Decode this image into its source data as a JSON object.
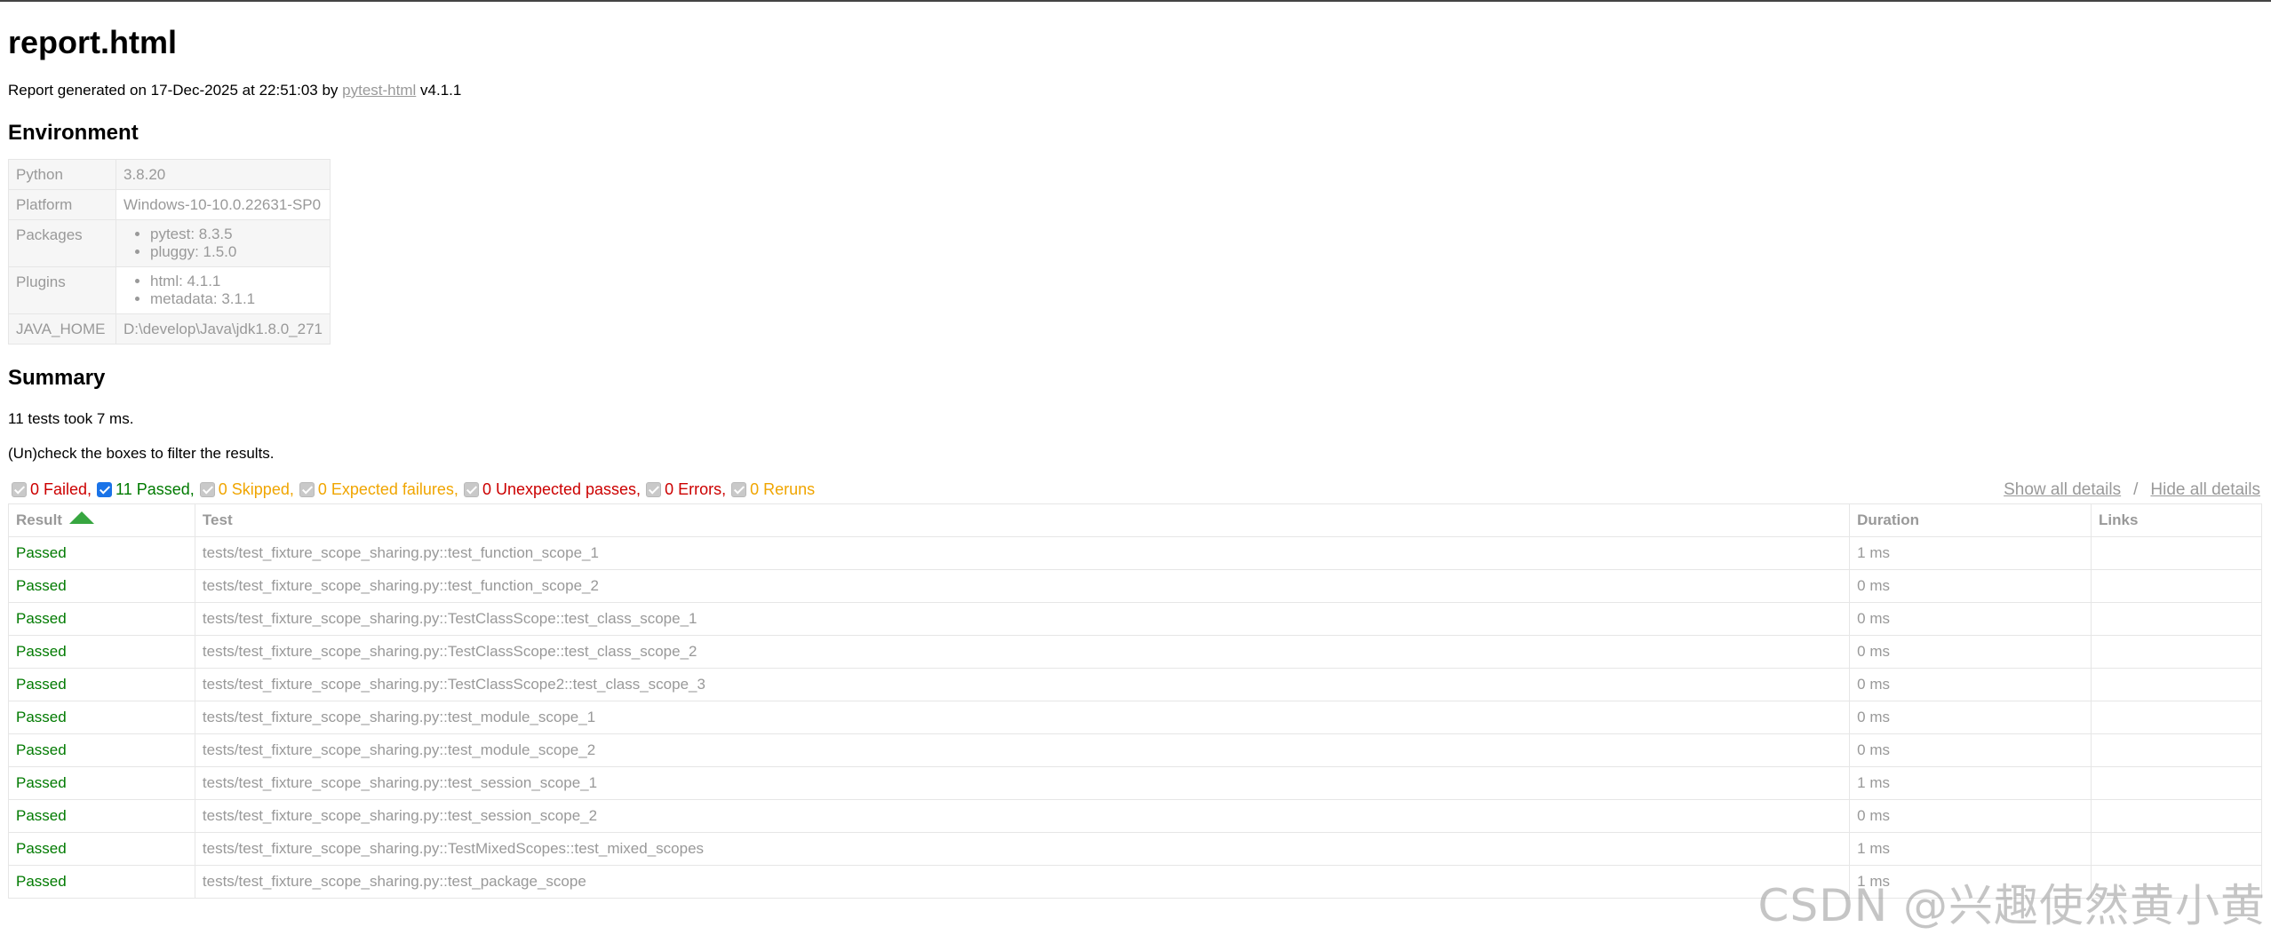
{
  "title": "report.html",
  "generated": {
    "prefix": "Report generated on 17-Dec-2025 at 22:51:03 by ",
    "link": "pytest-html",
    "suffix": " v4.1.1"
  },
  "environment": {
    "heading": "Environment",
    "python": {
      "key": "Python",
      "value": "3.8.20"
    },
    "platform": {
      "key": "Platform",
      "value": "Windows-10-10.0.22631-SP0"
    },
    "packages": {
      "key": "Packages",
      "items": [
        "pytest: 8.3.5",
        "pluggy: 1.5.0"
      ]
    },
    "plugins": {
      "key": "Plugins",
      "items": [
        "html: 4.1.1",
        "metadata: 3.1.1"
      ]
    },
    "java_home": {
      "key": "JAVA_HOME",
      "value": "D:\\develop\\Java\\jdk1.8.0_271"
    }
  },
  "summary": {
    "heading": "Summary",
    "took": "11 tests took 7 ms.",
    "filter_hint": "(Un)check the boxes to filter the results.",
    "filters": {
      "failed": "0 Failed,",
      "passed": "11 Passed,",
      "skipped": "0 Skipped,",
      "xfailed": "0 Expected failures,",
      "xpassed": "0 Unexpected passes,",
      "error": "0 Errors,",
      "rerun": "0 Reruns"
    },
    "show_all": "Show all details",
    "separator": "/",
    "hide_all": "Hide all details"
  },
  "table": {
    "headers": {
      "result": "Result",
      "test": "Test",
      "duration": "Duration",
      "links": "Links"
    },
    "rows": [
      {
        "result": "Passed",
        "test": "tests/test_fixture_scope_sharing.py::test_function_scope_1",
        "duration": "1 ms",
        "links": ""
      },
      {
        "result": "Passed",
        "test": "tests/test_fixture_scope_sharing.py::test_function_scope_2",
        "duration": "0 ms",
        "links": ""
      },
      {
        "result": "Passed",
        "test": "tests/test_fixture_scope_sharing.py::TestClassScope::test_class_scope_1",
        "duration": "0 ms",
        "links": ""
      },
      {
        "result": "Passed",
        "test": "tests/test_fixture_scope_sharing.py::TestClassScope::test_class_scope_2",
        "duration": "0 ms",
        "links": ""
      },
      {
        "result": "Passed",
        "test": "tests/test_fixture_scope_sharing.py::TestClassScope2::test_class_scope_3",
        "duration": "0 ms",
        "links": ""
      },
      {
        "result": "Passed",
        "test": "tests/test_fixture_scope_sharing.py::test_module_scope_1",
        "duration": "0 ms",
        "links": ""
      },
      {
        "result": "Passed",
        "test": "tests/test_fixture_scope_sharing.py::test_module_scope_2",
        "duration": "0 ms",
        "links": ""
      },
      {
        "result": "Passed",
        "test": "tests/test_fixture_scope_sharing.py::test_session_scope_1",
        "duration": "1 ms",
        "links": ""
      },
      {
        "result": "Passed",
        "test": "tests/test_fixture_scope_sharing.py::test_session_scope_2",
        "duration": "0 ms",
        "links": ""
      },
      {
        "result": "Passed",
        "test": "tests/test_fixture_scope_sharing.py::TestMixedScopes::test_mixed_scopes",
        "duration": "1 ms",
        "links": ""
      },
      {
        "result": "Passed",
        "test": "tests/test_fixture_scope_sharing.py::test_package_scope",
        "duration": "1 ms",
        "links": ""
      }
    ]
  },
  "watermark": "CSDN @兴趣使然黄小黄",
  "colors": {
    "passed": "#007a00",
    "failed": "#cc0000",
    "skipped": "#f0a500",
    "muted": "#999999",
    "sort_arrow": "#37a640",
    "checkbox_checked": "#1a73e8"
  },
  "icons": {
    "sort": "sort-ascending-arrow-icon"
  }
}
